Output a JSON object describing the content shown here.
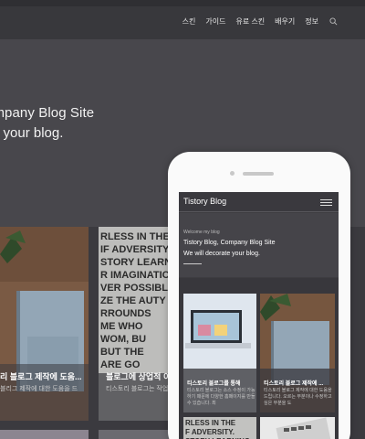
{
  "nav": {
    "items": [
      "스킨",
      "가이드",
      "유료 스킨",
      "배우기",
      "정보"
    ],
    "search_icon": "search-icon"
  },
  "hero": {
    "line1": "ompany Blog Site",
    "line2": "e your blog."
  },
  "cards": [
    {
      "title": "리 블로그 제작에 도움...",
      "subtitle": "블리그 제작에 대한 도움을 드"
    },
    {
      "title": "블로그에 상업적 이",
      "subtitle": "티스토리 블로그는 작업"
    }
  ],
  "phone": {
    "blog_title": "Tistory Blog",
    "menu_icon": "hamburger-menu-icon",
    "welcome": "Welcome my blog",
    "line1": "Tistory Blog, Company Blog Site",
    "line2": "We will decorate your blog.",
    "cards": [
      {
        "title": "티스토리 블로그를 통해",
        "subtitle": "티스토리 블로그는 소스 수정이 가능하기 때문에 다양한 홈페이지를 만들 수 있습니다. 최"
      },
      {
        "title": "티스토리 블로그 제작에 ...",
        "subtitle": "티스토리 블로그 제작에 대한 도움을 드립니다. 오르는 부분이나 수정하고 싶은 부분을 도"
      }
    ]
  },
  "colors": {
    "background": "#454449",
    "topbar": "#38383c",
    "phone_body": "#fafafa"
  }
}
